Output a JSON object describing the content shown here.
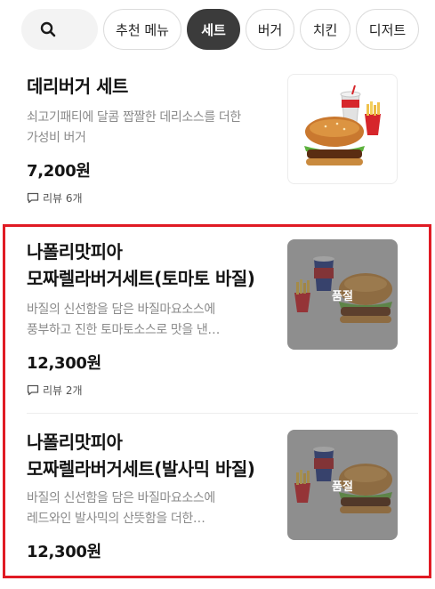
{
  "search": {
    "icon": "search-icon"
  },
  "categories": [
    {
      "label": "추천 메뉴",
      "active": false
    },
    {
      "label": "세트",
      "active": true
    },
    {
      "label": "버거",
      "active": false
    },
    {
      "label": "치킨",
      "active": false
    },
    {
      "label": "디저트",
      "active": false
    }
  ],
  "products": [
    {
      "name": "데리버거 세트",
      "desc_lines": [
        "쇠고기패티에 달콤 짭짤한 데리소스를 더한",
        "가성비 버거"
      ],
      "price": "7,200원",
      "review": "리뷰 6개",
      "sold_out": false
    },
    {
      "name_lines": [
        "나폴리맛피아",
        "모짜렐라버거세트(토마토 바질)"
      ],
      "desc_lines": [
        "바질의 신선함을 담은 바질마요소스에",
        "풍부하고 진한 토마토소스로 맛을 낸…"
      ],
      "price": "12,300원",
      "review": "리뷰 2개",
      "sold_out": true,
      "sold_out_label": "품절"
    },
    {
      "name_lines": [
        "나폴리맛피아",
        "모짜렐라버거세트(발사믹 바질)"
      ],
      "desc_lines": [
        "바질의 신선함을 담은 바질마요소스에",
        "레드와인 발사믹의 산뜻함을 더한…"
      ],
      "price": "12,300원",
      "sold_out": true,
      "sold_out_label": "품절"
    }
  ],
  "colors": {
    "active_chip": "#3b3b3b",
    "highlight_border": "#e01b24",
    "description_text": "#8a8a8a"
  }
}
